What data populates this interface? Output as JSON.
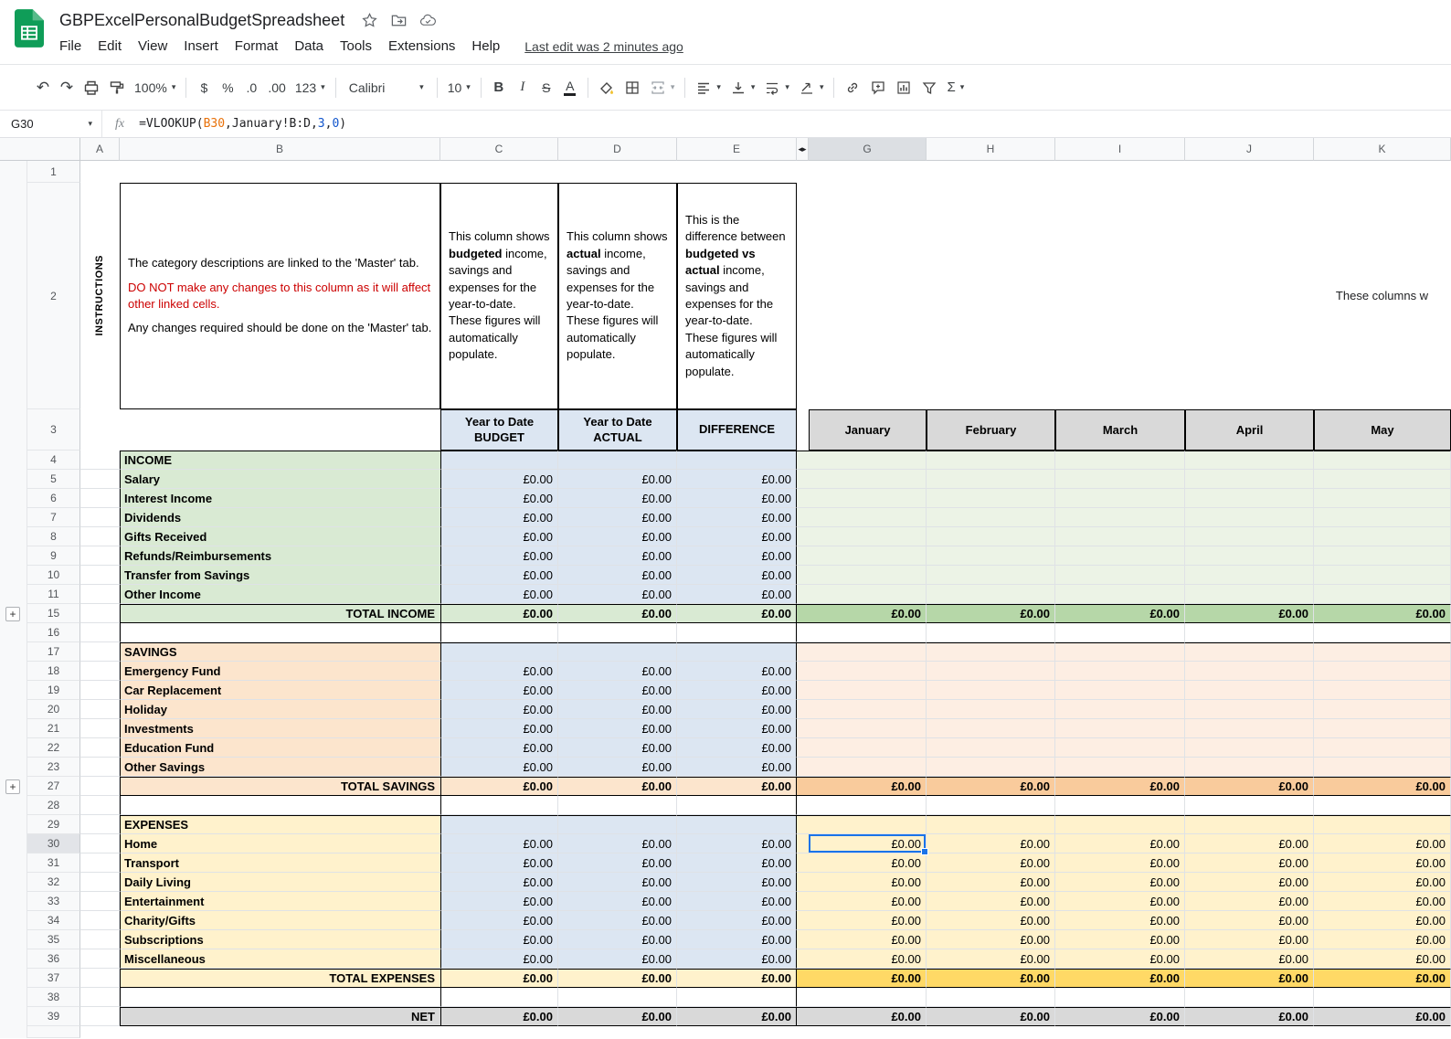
{
  "titlebar": {
    "title": "GBPExcelPersonalBudgetSpreadsheet",
    "last_edit": "Last edit was 2 minutes ago",
    "menus": [
      "File",
      "Edit",
      "View",
      "Insert",
      "Format",
      "Data",
      "Tools",
      "Extensions",
      "Help"
    ]
  },
  "toolbar": {
    "undo_icon": "↶",
    "redo_icon": "↷",
    "dropdown_arrow": "▾",
    "zoom": "100%",
    "currency": "$",
    "percent": "%",
    "decimal_decrease": ".0",
    "decimal_increase": ".00",
    "more_formats": "123",
    "font_name": "Calibri",
    "font_size": "10",
    "bold": "B",
    "italic": "I",
    "strikethrough": "S",
    "text_color": "A",
    "functions": "Σ"
  },
  "formula_bar": {
    "name_box": "G30",
    "fx_label": "fx",
    "formula": "=VLOOKUP(B30,January!B:D,3,0)",
    "formula_segments": [
      {
        "text": "=VLOOKUP(",
        "color": "#202124"
      },
      {
        "text": "B30",
        "color": "#e8710a"
      },
      {
        "text": ",January!B:D,",
        "color": "#202124"
      },
      {
        "text": "3",
        "color": "#1155cc"
      },
      {
        "text": ",",
        "color": "#202124"
      },
      {
        "text": "0",
        "color": "#1155cc"
      },
      {
        "text": ")",
        "color": "#202124"
      }
    ]
  },
  "grid": {
    "column_letters": [
      "A",
      "B",
      "C",
      "D",
      "E",
      "G",
      "H",
      "I",
      "J",
      "K"
    ],
    "hidden_column_marker": "◂▸",
    "selected": {
      "cell": "G30",
      "column": "G",
      "row": 30
    },
    "row1": {
      "number": "1"
    },
    "instructions_row": {
      "number": "2",
      "a_vertical_label": "INSTRUCTIONS",
      "b_paragraphs": [
        {
          "text": "The category descriptions are linked to the 'Master' tab.",
          "color": "#000000"
        },
        {
          "text": "DO NOT make any changes to this column as it will affect other linked cells.",
          "color": "#cc0000"
        },
        {
          "text": "Any changes required should be done on the 'Master' tab.",
          "color": "#000000"
        }
      ],
      "c_segments": [
        {
          "text": "This column shows "
        },
        {
          "text": "budgeted",
          "bold": true
        },
        {
          "text": " income, savings and expenses for the year-to-date. These figures will automatically populate."
        }
      ],
      "d_segments": [
        {
          "text": "This column shows "
        },
        {
          "text": "actual",
          "bold": true
        },
        {
          "text": " income, savings and expenses for the year-to-date. These figures will automatically populate."
        }
      ],
      "e_segments": [
        {
          "text": "This is the difference between "
        },
        {
          "text": "budgeted vs actual",
          "bold": true
        },
        {
          "text": " income, savings and expenses for the year-to-date. These figures will automatically populate."
        }
      ],
      "k_text": "These columns w"
    },
    "header_row": {
      "number": "3",
      "c": "Year to Date BUDGET",
      "d": "Year to Date ACTUAL",
      "e": "DIFFERENCE",
      "months": [
        "January",
        "February",
        "March",
        "April",
        "May"
      ]
    },
    "rows": [
      {
        "n": "4",
        "type": "section",
        "section": "income",
        "label": "INCOME",
        "cde": [
          "",
          "",
          ""
        ],
        "months": [
          "",
          "",
          "",
          "",
          ""
        ]
      },
      {
        "n": "5",
        "type": "item",
        "section": "income",
        "label": "Salary",
        "cde": [
          "£0.00",
          "£0.00",
          "£0.00"
        ],
        "months": [
          "",
          "",
          "",
          "",
          ""
        ]
      },
      {
        "n": "6",
        "type": "item",
        "section": "income",
        "label": "Interest Income",
        "cde": [
          "£0.00",
          "£0.00",
          "£0.00"
        ],
        "months": [
          "",
          "",
          "",
          "",
          ""
        ]
      },
      {
        "n": "7",
        "type": "item",
        "section": "income",
        "label": "Dividends",
        "cde": [
          "£0.00",
          "£0.00",
          "£0.00"
        ],
        "months": [
          "",
          "",
          "",
          "",
          ""
        ]
      },
      {
        "n": "8",
        "type": "item",
        "section": "income",
        "label": "Gifts Received",
        "cde": [
          "£0.00",
          "£0.00",
          "£0.00"
        ],
        "months": [
          "",
          "",
          "",
          "",
          ""
        ]
      },
      {
        "n": "9",
        "type": "item",
        "section": "income",
        "label": "Refunds/Reimbursements",
        "cde": [
          "£0.00",
          "£0.00",
          "£0.00"
        ],
        "months": [
          "",
          "",
          "",
          "",
          ""
        ]
      },
      {
        "n": "10",
        "type": "item",
        "section": "income",
        "label": "Transfer from Savings",
        "cde": [
          "£0.00",
          "£0.00",
          "£0.00"
        ],
        "months": [
          "",
          "",
          "",
          "",
          ""
        ]
      },
      {
        "n": "11",
        "type": "item",
        "section": "income",
        "label": "Other Income",
        "cde": [
          "£0.00",
          "£0.00",
          "£0.00"
        ],
        "months": [
          "",
          "",
          "",
          "",
          ""
        ]
      },
      {
        "n": "15",
        "type": "total",
        "section": "income",
        "label": "TOTAL INCOME",
        "expand": true,
        "cde": [
          "£0.00",
          "£0.00",
          "£0.00"
        ],
        "months": [
          "£0.00",
          "£0.00",
          "£0.00",
          "£0.00",
          "£0.00"
        ]
      },
      {
        "n": "16",
        "type": "blank"
      },
      {
        "n": "17",
        "type": "section",
        "section": "savings",
        "label": "SAVINGS",
        "cde": [
          "",
          "",
          ""
        ],
        "months": [
          "",
          "",
          "",
          "",
          ""
        ]
      },
      {
        "n": "18",
        "type": "item",
        "section": "savings",
        "label": "Emergency Fund",
        "cde": [
          "£0.00",
          "£0.00",
          "£0.00"
        ],
        "months": [
          "",
          "",
          "",
          "",
          ""
        ]
      },
      {
        "n": "19",
        "type": "item",
        "section": "savings",
        "label": "Car Replacement",
        "cde": [
          "£0.00",
          "£0.00",
          "£0.00"
        ],
        "months": [
          "",
          "",
          "",
          "",
          ""
        ]
      },
      {
        "n": "20",
        "type": "item",
        "section": "savings",
        "label": "Holiday",
        "cde": [
          "£0.00",
          "£0.00",
          "£0.00"
        ],
        "months": [
          "",
          "",
          "",
          "",
          ""
        ]
      },
      {
        "n": "21",
        "type": "item",
        "section": "savings",
        "label": "Investments",
        "cde": [
          "£0.00",
          "£0.00",
          "£0.00"
        ],
        "months": [
          "",
          "",
          "",
          "",
          ""
        ]
      },
      {
        "n": "22",
        "type": "item",
        "section": "savings",
        "label": "Education Fund",
        "cde": [
          "£0.00",
          "£0.00",
          "£0.00"
        ],
        "months": [
          "",
          "",
          "",
          "",
          ""
        ]
      },
      {
        "n": "23",
        "type": "item",
        "section": "savings",
        "label": "Other Savings",
        "cde": [
          "£0.00",
          "£0.00",
          "£0.00"
        ],
        "months": [
          "",
          "",
          "",
          "",
          ""
        ]
      },
      {
        "n": "27",
        "type": "total",
        "section": "savings",
        "label": "TOTAL SAVINGS",
        "expand": true,
        "cde": [
          "£0.00",
          "£0.00",
          "£0.00"
        ],
        "months": [
          "£0.00",
          "£0.00",
          "£0.00",
          "£0.00",
          "£0.00"
        ]
      },
      {
        "n": "28",
        "type": "blank"
      },
      {
        "n": "29",
        "type": "section",
        "section": "expenses",
        "label": "EXPENSES",
        "cde": [
          "",
          "",
          ""
        ],
        "months": [
          "",
          "",
          "",
          "",
          ""
        ]
      },
      {
        "n": "30",
        "type": "item",
        "section": "expenses",
        "label": "Home",
        "cde": [
          "£0.00",
          "£0.00",
          "£0.00"
        ],
        "months": [
          "£0.00",
          "£0.00",
          "£0.00",
          "£0.00",
          "£0.00"
        ]
      },
      {
        "n": "31",
        "type": "item",
        "section": "expenses",
        "label": "Transport",
        "cde": [
          "£0.00",
          "£0.00",
          "£0.00"
        ],
        "months": [
          "£0.00",
          "£0.00",
          "£0.00",
          "£0.00",
          "£0.00"
        ]
      },
      {
        "n": "32",
        "type": "item",
        "section": "expenses",
        "label": "Daily Living",
        "cde": [
          "£0.00",
          "£0.00",
          "£0.00"
        ],
        "months": [
          "£0.00",
          "£0.00",
          "£0.00",
          "£0.00",
          "£0.00"
        ]
      },
      {
        "n": "33",
        "type": "item",
        "section": "expenses",
        "label": "Entertainment",
        "cde": [
          "£0.00",
          "£0.00",
          "£0.00"
        ],
        "months": [
          "£0.00",
          "£0.00",
          "£0.00",
          "£0.00",
          "£0.00"
        ]
      },
      {
        "n": "34",
        "type": "item",
        "section": "expenses",
        "label": "Charity/Gifts",
        "cde": [
          "£0.00",
          "£0.00",
          "£0.00"
        ],
        "months": [
          "£0.00",
          "£0.00",
          "£0.00",
          "£0.00",
          "£0.00"
        ]
      },
      {
        "n": "35",
        "type": "item",
        "section": "expenses",
        "label": "Subscriptions",
        "cde": [
          "£0.00",
          "£0.00",
          "£0.00"
        ],
        "months": [
          "£0.00",
          "£0.00",
          "£0.00",
          "£0.00",
          "£0.00"
        ]
      },
      {
        "n": "36",
        "type": "item",
        "section": "expenses",
        "label": "Miscellaneous",
        "cde": [
          "£0.00",
          "£0.00",
          "£0.00"
        ],
        "months": [
          "£0.00",
          "£0.00",
          "£0.00",
          "£0.00",
          "£0.00"
        ]
      },
      {
        "n": "37",
        "type": "total",
        "section": "expenses",
        "label": "TOTAL EXPENSES",
        "cde": [
          "£0.00",
          "£0.00",
          "£0.00"
        ],
        "months": [
          "£0.00",
          "£0.00",
          "£0.00",
          "£0.00",
          "£0.00"
        ]
      },
      {
        "n": "38",
        "type": "blank"
      },
      {
        "n": "39",
        "type": "net",
        "label": "NET",
        "cde": [
          "£0.00",
          "£0.00",
          "£0.00"
        ],
        "months": [
          "£0.00",
          "£0.00",
          "£0.00",
          "£0.00",
          "£0.00"
        ]
      }
    ]
  },
  "colors": {
    "income_light": "#d9ead3",
    "income_month": "#ecf3e6",
    "income_total": "#b6d7a8",
    "savings_light": "#fce5cd",
    "savings_month": "#fdeee3",
    "savings_total": "#f9cb9c",
    "expenses_light": "#fff2cc",
    "expenses_month": "#fff2cc",
    "expenses_total": "#ffd966",
    "cde_fill": "#dce6f2",
    "month_header_fill": "#d9d9d9",
    "net_fill": "#d9d9d9",
    "selection_blue": "#1a73e8",
    "warning_red": "#cc0000",
    "logo_green": "#0f9d58"
  }
}
